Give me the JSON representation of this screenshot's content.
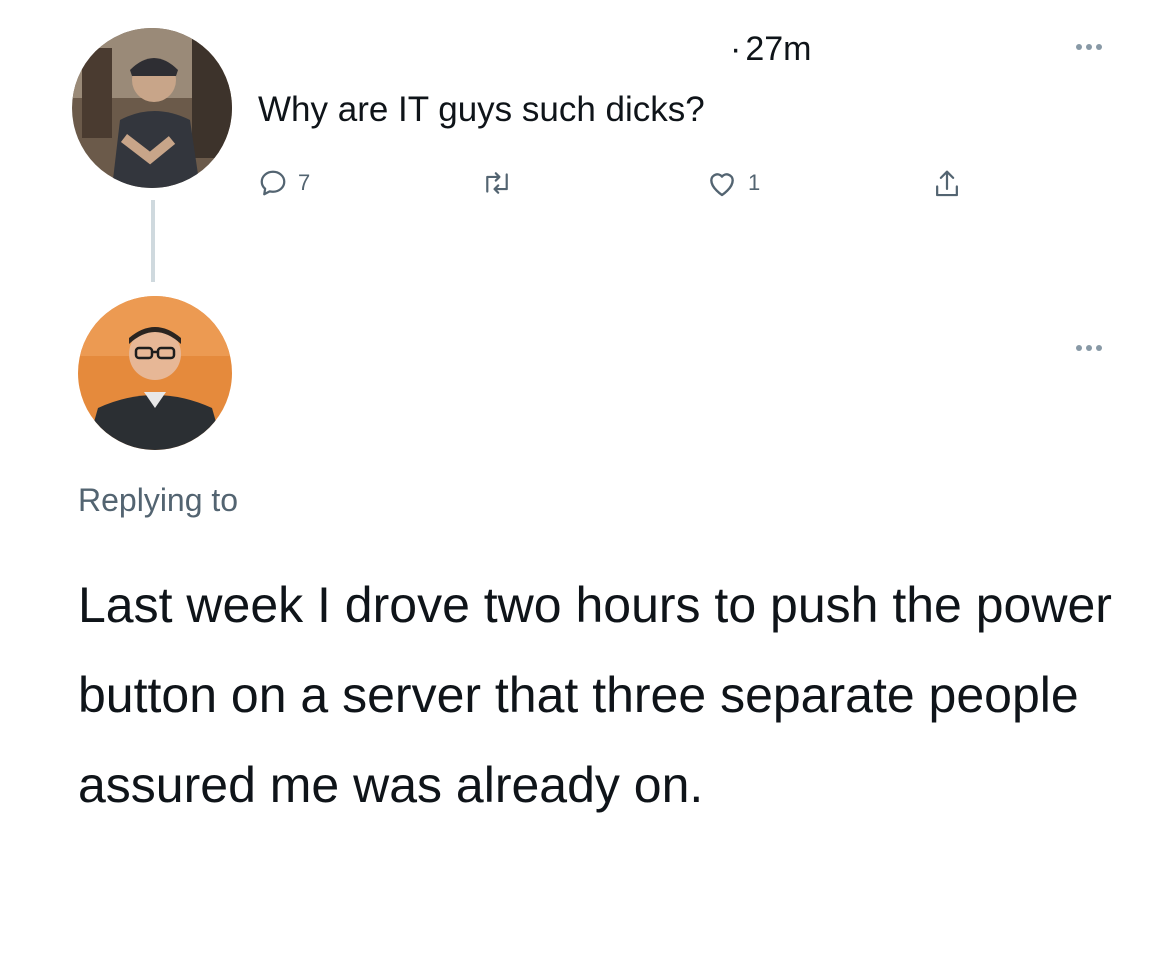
{
  "tweet": {
    "time_dot": "·",
    "time": "27m",
    "text": "Why are IT guys such dicks?",
    "reply_count": "7",
    "like_count": "1"
  },
  "reply": {
    "replying_to": "Replying to",
    "text": "Last week I drove two hours to push the power button on a server that three separate people assured me was already on."
  },
  "icons": {
    "reply": "speech-bubble-icon",
    "retweet": "retweet-icon",
    "like": "heart-icon",
    "share": "share-upload-icon",
    "more": "more-dots-icon"
  },
  "colors": {
    "text": "#0f1419",
    "muted": "#536471",
    "thread_line": "#cfd9de",
    "avatar_2_background": "#e58a3c"
  }
}
